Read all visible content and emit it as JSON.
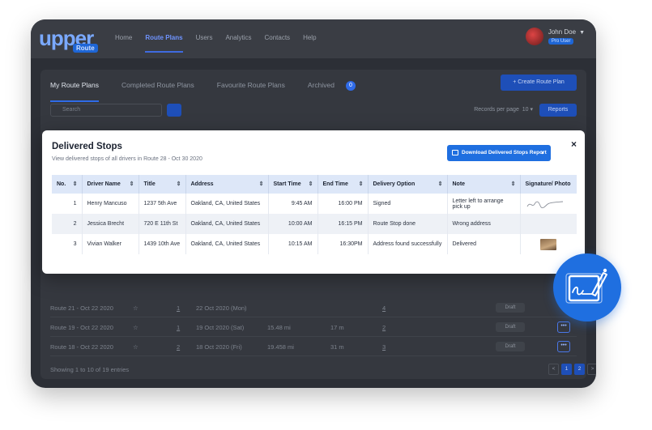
{
  "app": {
    "logo_text": "upper",
    "logo_sub": "Route",
    "nav": [
      "Home",
      "Route Plans",
      "Users",
      "Analytics",
      "Contacts",
      "Help"
    ],
    "active_nav": "Route Plans",
    "user_name": "John Doe",
    "user_badge": "Pro User"
  },
  "page": {
    "tabs": [
      "My Route Plans",
      "Completed Route Plans",
      "Favourite Route Plans",
      "Archived"
    ],
    "tab_count": "0",
    "create_button": "+  Create Route Plan",
    "search_placeholder": "Search",
    "records_label": "Records per page",
    "records_value": "10",
    "reports_button": "Reports",
    "rows": [
      {
        "name": "Route 21 - Oct 22 2020",
        "stops": "1",
        "date": "22 Oct 2020 (Mon)",
        "distance": "",
        "duration": "",
        "link": "4",
        "status": "Draft"
      },
      {
        "name": "Route 19 - Oct 22 2020",
        "stops": "1",
        "date": "19 Oct 2020 (Sat)",
        "distance": "15.48 mi",
        "duration": "17 m",
        "link": "2",
        "status": "Draft"
      },
      {
        "name": "Route 18 - Oct 22 2020",
        "stops": "2",
        "date": "18 Oct 2020 (Fri)",
        "distance": "19.458 mi",
        "duration": "31 m",
        "link": "3",
        "status": "Draft"
      }
    ],
    "showing": "Showing 1 to 10 of 19 entries",
    "pages": [
      "<",
      "1",
      "2",
      ">"
    ]
  },
  "modal": {
    "title": "Delivered Stops",
    "subtitle": "View delivered stops of all drivers in Route 28 - Oct 30 2020",
    "download_button": "Download Delivered Stops Report",
    "close": "×",
    "columns": [
      "No.",
      "Driver Name",
      "Title",
      "Address",
      "Start Time",
      "End Time",
      "Delivery Option",
      "Note",
      "Signature/ Photo"
    ],
    "rows": [
      {
        "no": "1",
        "driver": "Henry Mancuso",
        "title": "1237 5th Ave",
        "address": "Oakland, CA, United States",
        "start": "9:45 AM",
        "end": "16:00 PM",
        "option": "Signed",
        "note_1": "Letter left to arrange",
        "note_2": "pick up",
        "proof": "signature"
      },
      {
        "no": "2",
        "driver": "Jessica Brecht",
        "title": "720 E 11th St",
        "address": "Oakland, CA, United States",
        "start": "10:00 AM",
        "end": "16:15 PM",
        "option": "Route Stop done",
        "note_1": "Wrong address",
        "note_2": "",
        "proof": "none"
      },
      {
        "no": "3",
        "driver": "Vivian Walker",
        "title": "1439 10th Ave",
        "address": "Oakland, CA, United States",
        "start": "10:15 AM",
        "end": "16:30PM",
        "option": "Address found successfully",
        "note_1": "Delivered",
        "note_2": "",
        "proof": "photo"
      }
    ]
  },
  "colors": {
    "accent": "#1f6fe0",
    "header_bg": "#dde7f8",
    "backdrop": "#2c2f36"
  },
  "icons": [
    "sort-icon",
    "close-icon",
    "download-icon",
    "search-icon",
    "star-icon",
    "more-icon",
    "signature-pad-icon"
  ]
}
